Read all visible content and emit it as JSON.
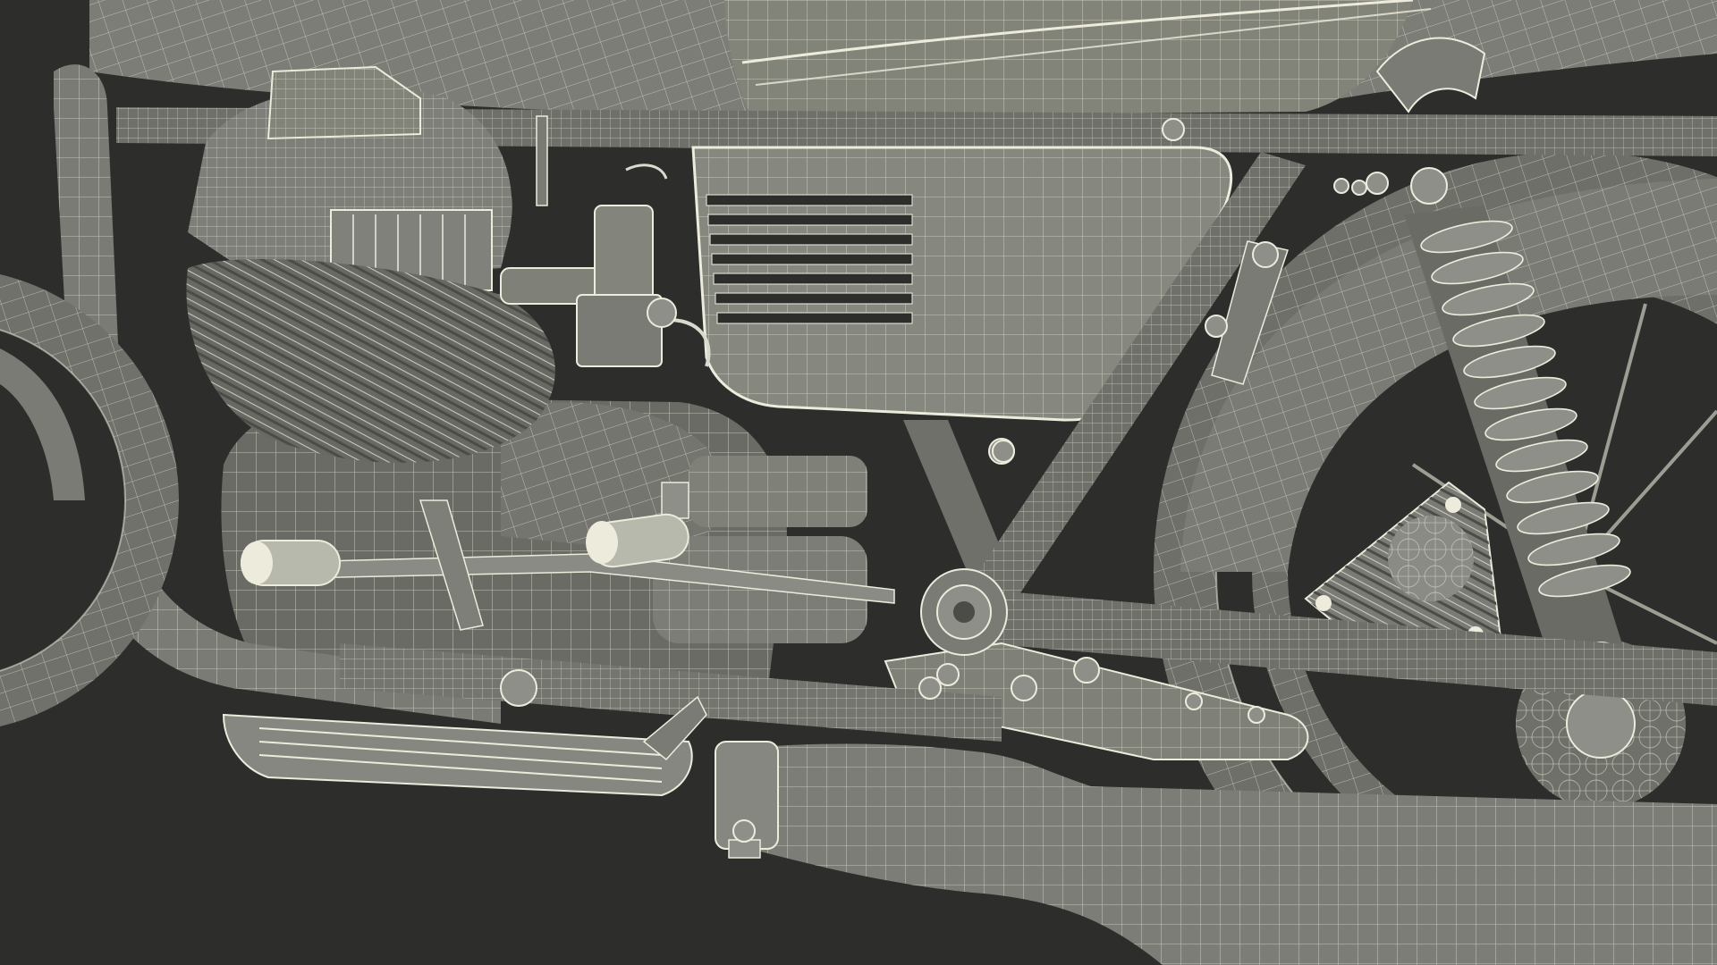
{
  "scene": {
    "subject": "motorcycle",
    "render_style": "wireframe-on-shaded",
    "colors": {
      "background": "#2d2e2c",
      "surface": "#7a7b74",
      "surface_light": "#8e8f88",
      "surface_dark": "#5f605a",
      "wire": "#d9dacd",
      "wire_dim": "#b8b9ad",
      "highlight": "#ecebdc"
    }
  }
}
